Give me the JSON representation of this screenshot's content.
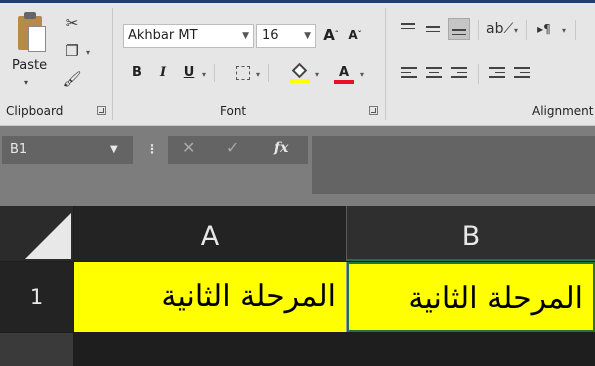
{
  "ribbon": {
    "clipboard": {
      "group_label": "Clipboard",
      "paste_label": "Paste",
      "cut_icon": "scissors-icon",
      "copy_icon": "copy-icon",
      "format_painter_icon": "format-painter-icon"
    },
    "font": {
      "group_label": "Font",
      "font_name": "Akhbar MT",
      "font_size": "16",
      "grow_label": "A",
      "shrink_label": "A",
      "bold_label": "B",
      "italic_label": "I",
      "underline_label": "U",
      "font_color_label": "A",
      "font_color": "#e81123",
      "fill_color": "#ffff00"
    },
    "alignment": {
      "group_label": "Alignment"
    }
  },
  "formula_bar": {
    "name_box": "B1",
    "cancel_icon": "✕",
    "enter_icon": "✓",
    "function_icon": "fx",
    "formula": ""
  },
  "sheet": {
    "columns": [
      "A",
      "B"
    ],
    "rows": [
      {
        "header": "1",
        "cells": [
          "المرحلة الثانية",
          "المرحلة الثانية"
        ]
      }
    ],
    "selected_cell": "B1",
    "cell_fill": "#ffff00",
    "selection_color": "#217346"
  }
}
